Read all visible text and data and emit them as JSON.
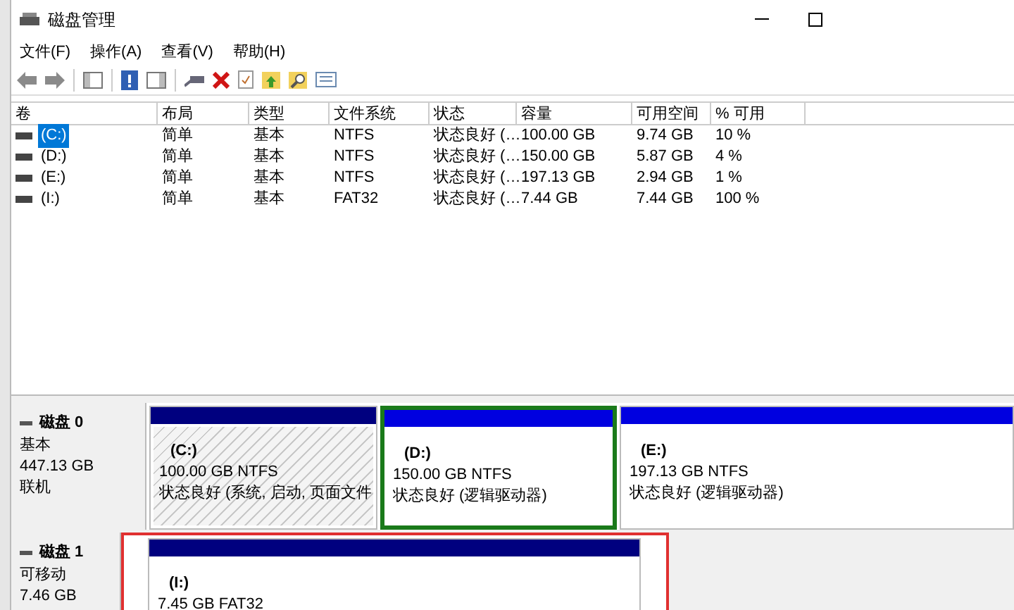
{
  "window": {
    "title": "磁盘管理"
  },
  "menu": [
    "文件(F)",
    "操作(A)",
    "查看(V)",
    "帮助(H)"
  ],
  "table": {
    "columns": [
      "卷",
      "布局",
      "类型",
      "文件系统",
      "状态",
      "容量",
      "可用空间",
      "% 可用"
    ],
    "rows": [
      {
        "selected": true,
        "cells": [
          "(C:)",
          "简单",
          "基本",
          "NTFS",
          "状态良好 (…",
          "100.00 GB",
          "9.74 GB",
          "10 %"
        ]
      },
      {
        "selected": false,
        "cells": [
          "(D:)",
          "简单",
          "基本",
          "NTFS",
          "状态良好 (…",
          "150.00 GB",
          "5.87 GB",
          "4 %"
        ]
      },
      {
        "selected": false,
        "cells": [
          "(E:)",
          "简单",
          "基本",
          "NTFS",
          "状态良好 (…",
          "197.13 GB",
          "2.94 GB",
          "1 %"
        ]
      },
      {
        "selected": false,
        "cells": [
          "(I:)",
          "简单",
          "基本",
          "FAT32",
          "状态良好 (…",
          "7.44 GB",
          "7.44 GB",
          "100 %"
        ]
      }
    ]
  },
  "disks": [
    {
      "name": "磁盘 0",
      "type": "基本",
      "size": "447.13 GB",
      "state": "联机",
      "highlighted": false,
      "partitions": [
        {
          "kind": "primary",
          "label": "(C:)",
          "size": "100.00 GB NTFS",
          "status": "状态良好 (系统, 启动, 页面文件",
          "selected": false,
          "hatched": true
        },
        {
          "kind": "logical",
          "label": "(D:)",
          "size": "150.00 GB NTFS",
          "status": "状态良好 (逻辑驱动器)",
          "selected": true,
          "hatched": false
        },
        {
          "kind": "logical",
          "label": "(E:)",
          "size": "197.13 GB NTFS",
          "status": "状态良好 (逻辑驱动器)",
          "selected": false,
          "hatched": false
        }
      ]
    },
    {
      "name": "磁盘 1",
      "type": "可移动",
      "size": "7.46 GB",
      "highlighted": true,
      "partitions": [
        {
          "kind": "primary",
          "label": "(I:)",
          "size": "7.45 GB FAT32",
          "selected": false,
          "hatched": false
        }
      ]
    }
  ]
}
